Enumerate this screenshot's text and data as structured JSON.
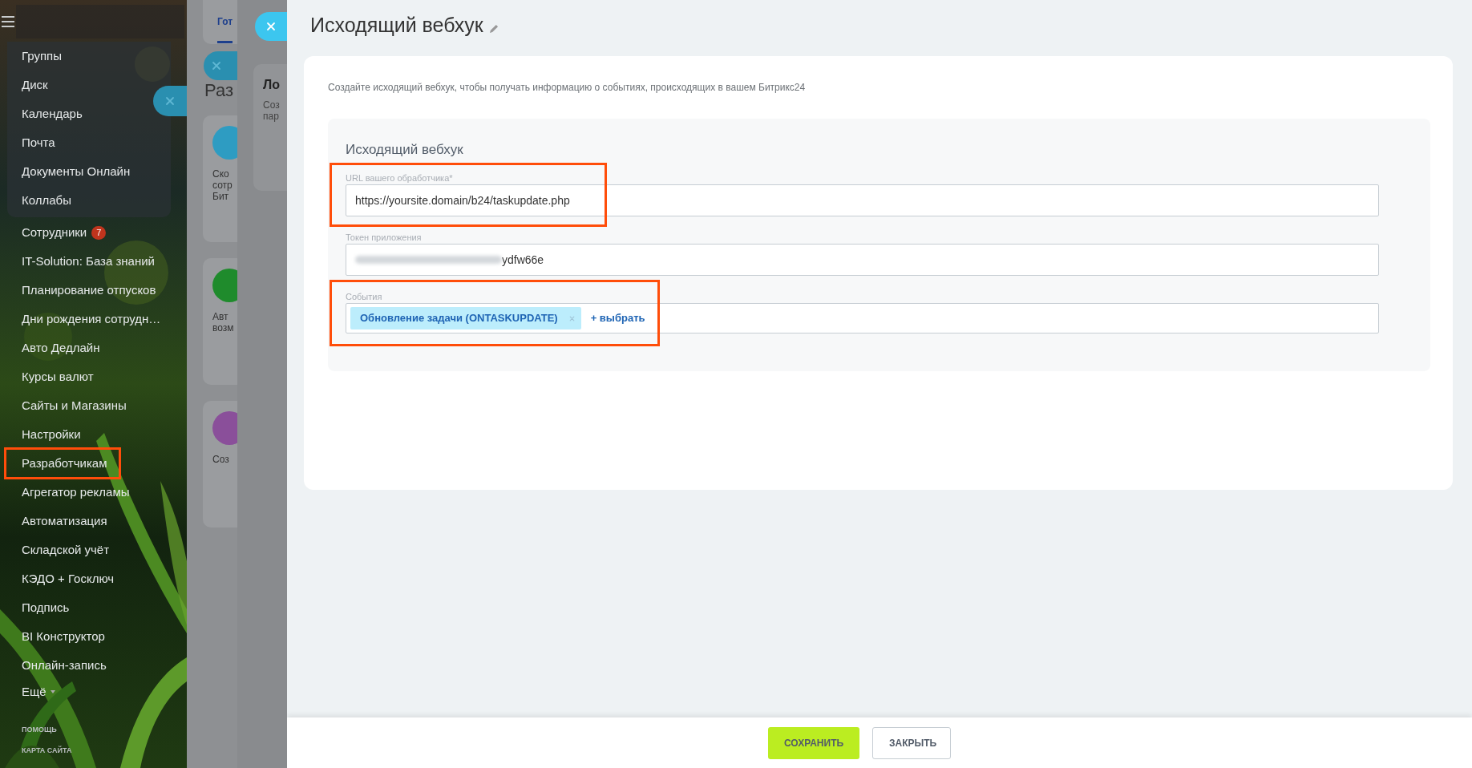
{
  "sidebar": {
    "group_items": [
      {
        "label": "Группы"
      },
      {
        "label": "Диск"
      },
      {
        "label": "Календарь"
      },
      {
        "label": "Почта"
      },
      {
        "label": "Документы Онлайн"
      },
      {
        "label": "Коллабы"
      }
    ],
    "items": [
      {
        "label": "Сотрудники",
        "badge": "7",
        "highlighted": false
      },
      {
        "label": "IT-Solution: База знаний",
        "highlighted": false
      },
      {
        "label": "Планирование отпусков",
        "highlighted": false
      },
      {
        "label": "Дни рождения сотрудн…",
        "highlighted": false
      },
      {
        "label": "Авто Дедлайн",
        "highlighted": false
      },
      {
        "label": "Курсы валют",
        "highlighted": false
      },
      {
        "label": "Сайты и Магазины",
        "highlighted": false
      },
      {
        "label": "Настройки",
        "highlighted": false
      },
      {
        "label": "Разработчикам",
        "highlighted": true
      },
      {
        "label": "Агрегатор рекламы",
        "highlighted": false
      },
      {
        "label": "Автоматизация",
        "highlighted": false
      },
      {
        "label": "Складской учёт",
        "highlighted": false
      },
      {
        "label": "КЭДО + Госключ",
        "highlighted": false
      },
      {
        "label": "Подпись",
        "highlighted": false
      },
      {
        "label": "BI Конструктор",
        "highlighted": false
      },
      {
        "label": "Онлайн-запись",
        "highlighted": false
      }
    ],
    "more": "Ещё",
    "footer_links": [
      "ПОМОЩЬ",
      "КАРТА САЙТА"
    ]
  },
  "background_page": {
    "tab": "Гот",
    "title": "Раз",
    "cards": [
      {
        "lines": [
          "Ско",
          "сотр",
          "Бит"
        ],
        "color": "#2e9cc2"
      },
      {
        "lines": [
          "Авт",
          "возм"
        ],
        "color": "#1f8b2c"
      },
      {
        "lines": [
          "Соз"
        ],
        "color": "#8a4f9a"
      }
    ]
  },
  "overlay_panel": {
    "card_title": "Ло",
    "card_lines": [
      "Соз",
      "пар"
    ]
  },
  "panel": {
    "title": "Исходящий вебхук",
    "description": "Создайте исходящий вебхук, чтобы получать информацию о событиях, происходящих в вашем Битрикс24",
    "section_title": "Исходящий вебхук",
    "fields": [
      {
        "kind": "text",
        "label": "URL вашего обработчика*",
        "value": "https://yoursite.domain/b24/taskupdate.php",
        "highlighted": true
      },
      {
        "kind": "token",
        "label": "Токен приложения",
        "value": "ydfw66e",
        "highlighted": false
      },
      {
        "kind": "tags",
        "label": "События",
        "tags": [
          "Обновление задачи (ONTASKUPDATE)"
        ],
        "add_link": "+ выбрать",
        "highlighted": true
      }
    ]
  },
  "buttons": [
    {
      "label": "СОХРАНИТЬ",
      "kind": "primary"
    },
    {
      "label": "ЗАКРЫТЬ",
      "kind": "secondary"
    }
  ]
}
